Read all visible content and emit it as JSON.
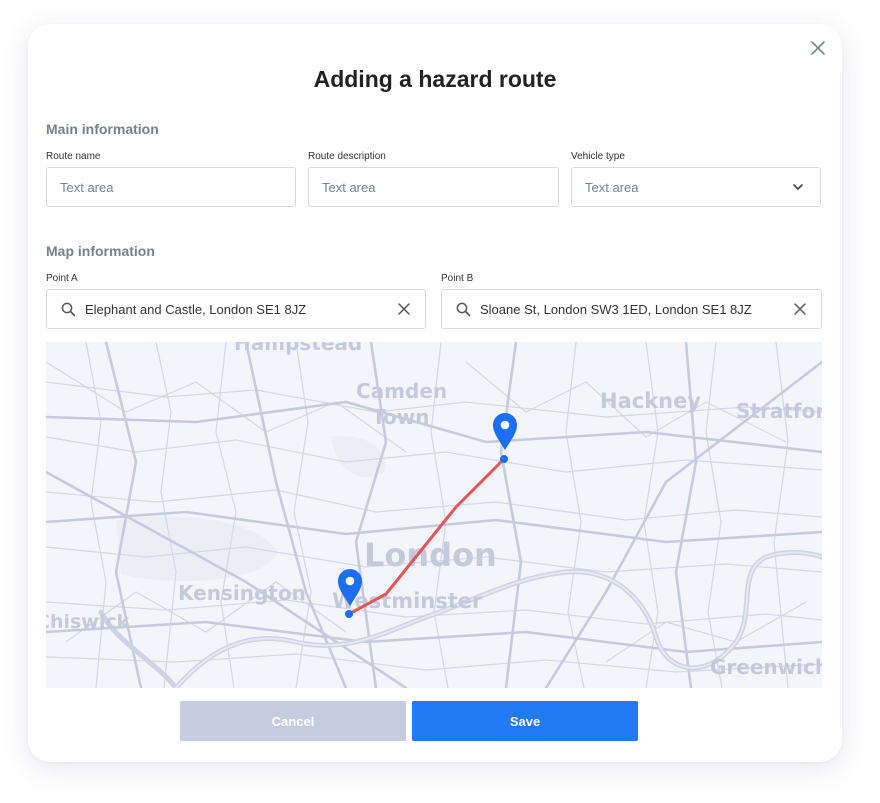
{
  "dialog": {
    "title": "Adding a hazard route",
    "close_icon": "close-icon"
  },
  "main_info": {
    "heading": "Main information",
    "route_name": {
      "label": "Route name",
      "placeholder": "Text area"
    },
    "route_description": {
      "label": "Route description",
      "placeholder": "Text area"
    },
    "vehicle_type": {
      "label": "Vehicle type",
      "placeholder": "Text area",
      "icon": "chevron-down-icon"
    }
  },
  "map_info": {
    "heading": "Map information",
    "point_a": {
      "label": "Point A",
      "value": "Elephant and Castle, London SE1 8JZ",
      "icon": "search-icon",
      "clear_icon": "close-icon"
    },
    "point_b": {
      "label": "Point B",
      "value": "Sloane St, London SW3 1ED, London SE1 8JZ",
      "icon": "search-icon",
      "clear_icon": "close-icon"
    }
  },
  "map": {
    "place_labels": {
      "hampstead": "Hampstead",
      "camden": "Camden",
      "town": "Town",
      "hackney": "Hackney",
      "stratford": "Stratford",
      "london": "London",
      "kensington": "Kensington",
      "westminster": "Westminster",
      "chiswick": "Chiswick",
      "greenwich": "Greenwich"
    },
    "route_color": "#e0565b",
    "marker_color": "#1d6ff2",
    "road_color": "#c5cadf"
  },
  "actions": {
    "cancel_label": "Cancel",
    "save_label": "Save"
  },
  "colors": {
    "primary": "#2479f5",
    "disabled": "#c5ccdf"
  }
}
